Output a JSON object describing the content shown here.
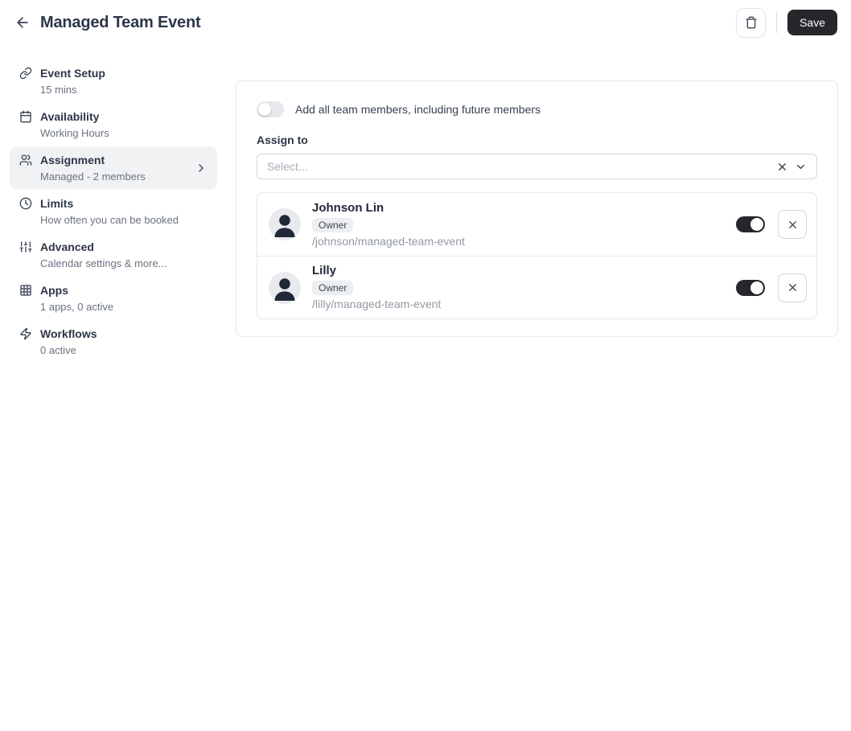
{
  "header": {
    "title": "Managed Team Event",
    "back_icon": "arrow-left-icon",
    "delete_icon": "trash-icon",
    "save_label": "Save"
  },
  "sidebar": {
    "items": [
      {
        "icon": "link-icon",
        "label": "Event Setup",
        "sub": "15 mins",
        "selected": false
      },
      {
        "icon": "calendar-icon",
        "label": "Availability",
        "sub": "Working Hours",
        "selected": false
      },
      {
        "icon": "users-icon",
        "label": "Assignment",
        "sub": "Managed - 2 members",
        "selected": true
      },
      {
        "icon": "clock-icon",
        "label": "Limits",
        "sub": "How often you can be booked",
        "selected": false
      },
      {
        "icon": "sliders-icon",
        "label": "Advanced",
        "sub": "Calendar settings & more...",
        "selected": false
      },
      {
        "icon": "grid-icon",
        "label": "Apps",
        "sub": "1 apps, 0 active",
        "selected": false
      },
      {
        "icon": "zap-icon",
        "label": "Workflows",
        "sub": "0 active",
        "selected": false
      }
    ]
  },
  "main": {
    "add_all": {
      "label": "Add all team members, including future members",
      "on": false
    },
    "assign_to": {
      "label": "Assign to",
      "placeholder": "Select..."
    },
    "members": [
      {
        "name": "Johnson Lin",
        "role": "Owner",
        "url": "/johnson/managed-team-event",
        "enabled": true
      },
      {
        "name": "Lilly",
        "role": "Owner",
        "url": "/lilly/managed-team-event",
        "enabled": true
      }
    ]
  },
  "colors": {
    "primary_dark": "#26272b",
    "selected_item_bg": "#f1f2f4",
    "badge_bg": "#eceef1",
    "card_border": "#e5e7eb",
    "muted_text": "#9199a4"
  }
}
